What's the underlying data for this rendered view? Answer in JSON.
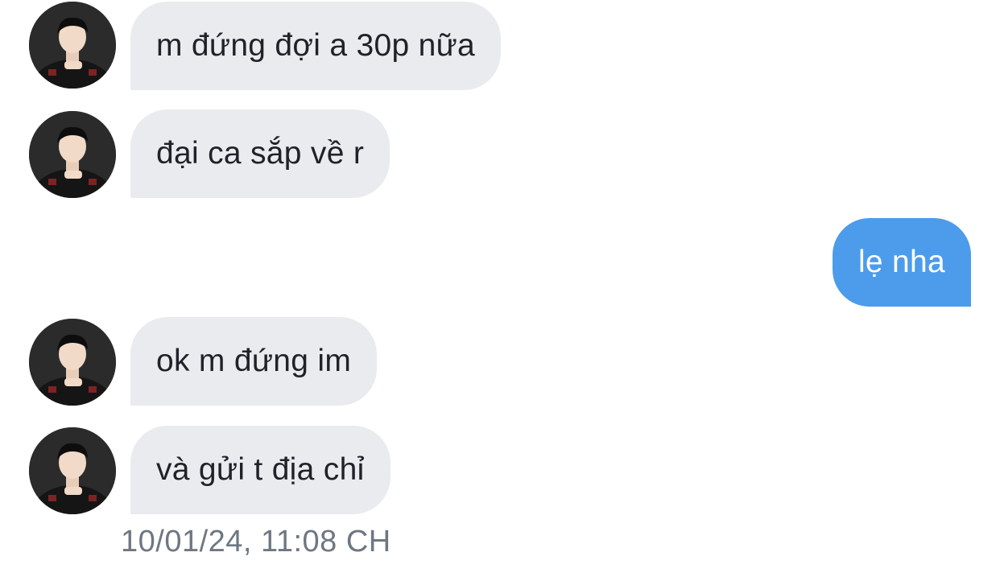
{
  "conversation": {
    "messages": [
      {
        "direction": "incoming",
        "text": "m đứng đợi a 30p nữa",
        "avatar": "contact-avatar"
      },
      {
        "direction": "incoming",
        "text": "đại ca sắp về r",
        "avatar": "contact-avatar"
      },
      {
        "direction": "outgoing",
        "text": "lẹ nha"
      },
      {
        "direction": "incoming",
        "text": "ok m đứng im",
        "avatar": "contact-avatar"
      },
      {
        "direction": "incoming",
        "text": "và gửi t địa chỉ",
        "avatar": "contact-avatar"
      }
    ],
    "timestamp": "10/01/24, 11:08 CH"
  },
  "colors": {
    "incoming_bubble": "#e9ebef",
    "outgoing_bubble": "#4c9ceb",
    "incoming_text": "#1f2228",
    "outgoing_text": "#ffffff",
    "timestamp_text": "#6e7781"
  }
}
